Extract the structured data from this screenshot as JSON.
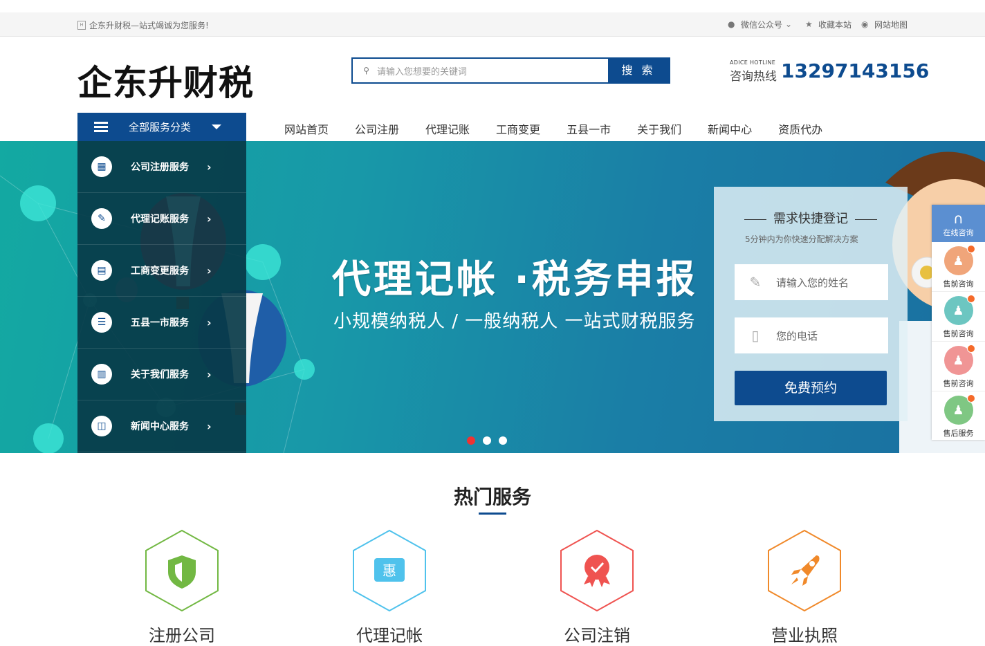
{
  "topbar": {
    "welcome": "企东升财税—站式竭诚为您服务!",
    "wechat": "微信公众号",
    "favorite": "收藏本站",
    "sitemap": "网站地图"
  },
  "header": {
    "logo": "企东升财税",
    "search_placeholder": "请输入您想要的关键词",
    "search_button": "搜 索",
    "hotline_en": "ADICE HOTLINE",
    "hotline_cn": "咨询热线",
    "hotline_number": "13297143156"
  },
  "nav": {
    "category_label": "全部服务分类",
    "items": [
      "网站首页",
      "公司注册",
      "代理记账",
      "工商变更",
      "五县一市",
      "关于我们",
      "新闻中心",
      "资质代办"
    ]
  },
  "sidebar": {
    "items": [
      {
        "label": "公司注册服务",
        "icon": "bank-icon"
      },
      {
        "label": "代理记账服务",
        "icon": "edit-icon"
      },
      {
        "label": "工商变更服务",
        "icon": "document-icon"
      },
      {
        "label": "五县一市服务",
        "icon": "user-card-icon"
      },
      {
        "label": "关于我们服务",
        "icon": "table-icon"
      },
      {
        "label": "新闻中心服务",
        "icon": "grid-icon"
      }
    ]
  },
  "banner": {
    "title": "代理记帐 ·税务申报",
    "subtitle": "小规模纳税人 / 一般纳税人   一站式财税服务",
    "active_slide": 1,
    "slide_count": 3
  },
  "form": {
    "title": "需求快捷登记",
    "tip": "5分钟内为你快速分配解决方案",
    "name_placeholder": "请输入您的姓名",
    "phone_placeholder": "您的电话",
    "submit": "免费预约"
  },
  "float_panel": {
    "online": "在线咨询",
    "items": [
      {
        "label": "售前咨询",
        "color": "#f0a57a"
      },
      {
        "label": "售前咨询",
        "color": "#6cc6c1"
      },
      {
        "label": "售前咨询",
        "color": "#f09595"
      },
      {
        "label": "售后服务",
        "color": "#7fc783"
      }
    ]
  },
  "hot": {
    "title": "热门服务",
    "services": [
      {
        "label": "注册公司",
        "color": "#72b843",
        "icon": "shield-icon"
      },
      {
        "label": "代理记帐",
        "color": "#4fc2ec",
        "icon": "coupon-icon",
        "glyph": "惠"
      },
      {
        "label": "公司注销",
        "color": "#ef5350",
        "icon": "badge-icon"
      },
      {
        "label": "营业执照",
        "color": "#f0892a",
        "icon": "rocket-icon"
      }
    ]
  }
}
